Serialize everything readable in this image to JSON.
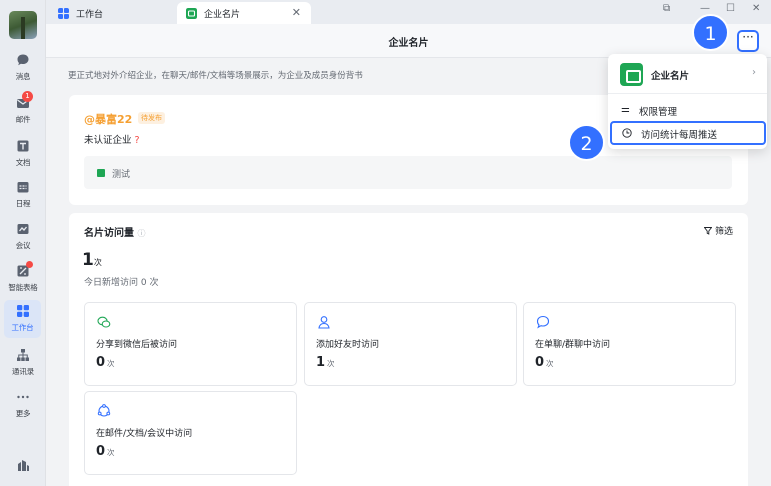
{
  "nav": {
    "items": [
      {
        "label": "消息"
      },
      {
        "label": "邮件",
        "badge": "1"
      },
      {
        "label": "文档"
      },
      {
        "label": "日程"
      },
      {
        "label": "会议"
      },
      {
        "label": "智能表格"
      },
      {
        "label": "工作台"
      },
      {
        "label": "通讯录"
      },
      {
        "label": "更多"
      }
    ]
  },
  "tabs": [
    {
      "label": "工作台"
    },
    {
      "label": "企业名片"
    }
  ],
  "header": {
    "title": "企业名片",
    "more": "···"
  },
  "intro": "更正式地对外介绍企业，在聊天/邮件/文档等场景展示，为企业及成员身份背书",
  "company": {
    "name": "@暴富22",
    "status_badge": "待发布",
    "unverified": "未认证企业",
    "help": "?",
    "tag": "测试"
  },
  "stats": {
    "title": "名片访问量",
    "info": "ⓘ",
    "filter": "筛选",
    "total": "1",
    "total_unit": "次",
    "today": "今日新增访问 0 次",
    "boxes": [
      {
        "label": "分享到微信后被访问",
        "value": "0",
        "unit": "次"
      },
      {
        "label": "添加好友时访问",
        "value": "1",
        "unit": "次"
      },
      {
        "label": "在单聊/群聊中访问",
        "value": "0",
        "unit": "次"
      },
      {
        "label": "在邮件/文档/会议中访问",
        "value": "0",
        "unit": "次"
      }
    ]
  },
  "popup": {
    "title": "企业名片",
    "arrow": "›",
    "items": [
      {
        "label": "权限管理"
      },
      {
        "label": "访问统计每周推送"
      }
    ]
  },
  "steps": [
    "1",
    "2"
  ],
  "colors": {
    "accent": "#3370ff",
    "brand_green": "#1ea654",
    "warn_orange": "#f5a033",
    "badge_red": "#f54a45"
  }
}
